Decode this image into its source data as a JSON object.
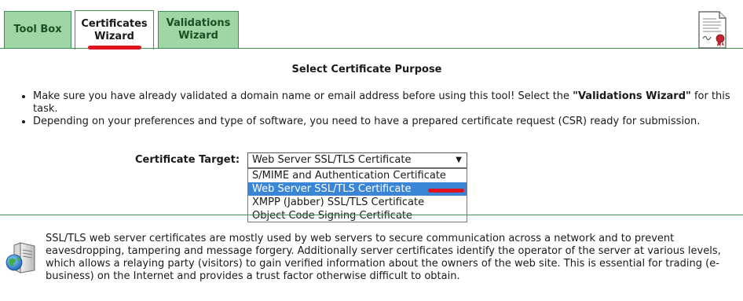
{
  "tabs": [
    {
      "label": "Tool Box",
      "active": false
    },
    {
      "label": "Certificates\nWizard",
      "active": true
    },
    {
      "label": "Validations\nWizard",
      "active": false
    }
  ],
  "colors": {
    "tab_green": "#9ed7a5",
    "tab_border": "#3d9150",
    "highlight": "#3a86d6",
    "annotation_red": "#e0141e"
  },
  "icons": {
    "certificate_document": "certificate-document-icon",
    "server_globe": "server-globe-icon"
  },
  "main": {
    "title": "Select Certificate Purpose",
    "bullets": [
      {
        "before": "Make sure you have already validated a domain name or email address before using this tool! Select the ",
        "bold": "\"Validations Wizard\"",
        "after": " for this task."
      },
      {
        "text": "Depending on your preferences and type of software, you need to have a prepared certificate request (CSR) ready for submission."
      }
    ],
    "target_label": "Certificate Target:",
    "select": {
      "value": "Web Server SSL/TLS Certificate",
      "arrow": "▼",
      "options": [
        "S/MIME and Authentication Certificate",
        "Web Server SSL/TLS Certificate",
        "XMPP (Jabber) SSL/TLS Certificate",
        "Object Code Signing Certificate"
      ],
      "highlighted_index": 1
    },
    "description": "SSL/TLS web server certificates are mostly used by web servers to secure communication across a network and to prevent eavesdropping, tampering and message forgery. Additionally server certificates identify the operator of the server at various levels, which allows a relaying party (visitors) to gain verified information about the owners of the web site. This is essential for trading (e-business) on the Internet and provides a trust factor otherwise difficult to obtain."
  }
}
